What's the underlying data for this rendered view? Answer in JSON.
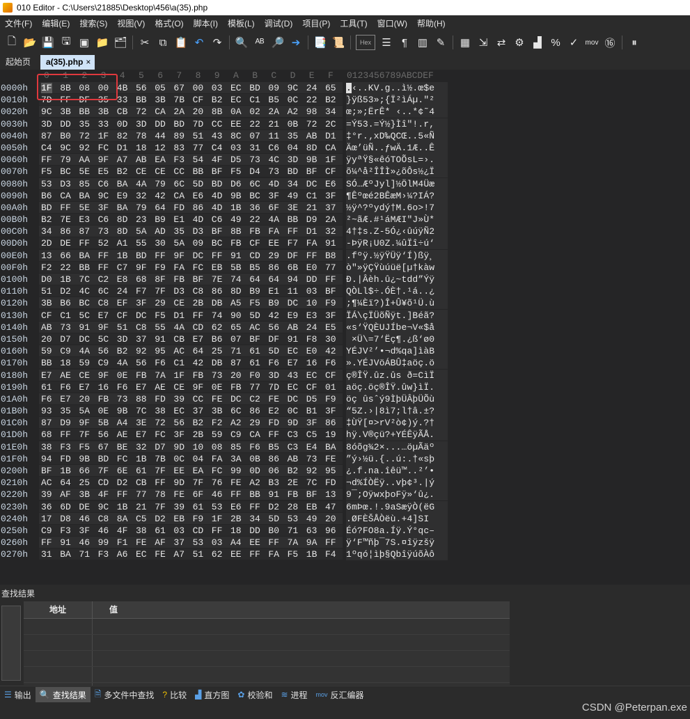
{
  "window": {
    "title": "010 Editor - C:\\Users\\21885\\Desktop\\456\\a(35).php"
  },
  "menu": [
    "文件(F)",
    "编辑(E)",
    "搜索(S)",
    "视图(V)",
    "格式(O)",
    "脚本(I)",
    "模板(L)",
    "调试(D)",
    "项目(P)",
    "工具(T)",
    "窗口(W)",
    "帮助(H)"
  ],
  "toolbar": {
    "hex_label": "Hex",
    "mov_label": "mov"
  },
  "tabs": {
    "start": "起始页",
    "active": "a(35).php",
    "close": "×"
  },
  "editor": {
    "columns": [
      "0",
      "1",
      "2",
      "3",
      "4",
      "5",
      "6",
      "7",
      "8",
      "9",
      "A",
      "B",
      "C",
      "D",
      "E",
      "F"
    ],
    "ascii_header": "0123456789ABCDEF",
    "rows": [
      {
        "addr": "0000h",
        "hex": [
          "1F",
          "8B",
          "08",
          "00",
          "4B",
          "56",
          "05",
          "67",
          "00",
          "03",
          "EC",
          "BD",
          "09",
          "9C",
          "24",
          "65"
        ],
        "ascii": ".‹..KV.g..ì½.œ$e"
      },
      {
        "addr": "0010h",
        "hex": [
          "7D",
          "FF",
          "DF",
          "35",
          "33",
          "BB",
          "3B",
          "7B",
          "CF",
          "B2",
          "EC",
          "C1",
          "B5",
          "0C",
          "22",
          "B2"
        ],
        "ascii": "}ÿß53»;{Ï²ìÁµ.\"²"
      },
      {
        "addr": "0020h",
        "hex": [
          "9C",
          "3B",
          "BB",
          "3B",
          "CB",
          "72",
          "CA",
          "2A",
          "20",
          "8B",
          "0A",
          "02",
          "2A",
          "A2",
          "98",
          "34"
        ],
        "ascii": "œ;»;ËrÊ* ‹..*¢˜4"
      },
      {
        "addr": "0030h",
        "hex": [
          "3D",
          "DD",
          "35",
          "33",
          "0D",
          "3D",
          "DD",
          "BD",
          "7D",
          "CC",
          "EE",
          "22",
          "21",
          "0B",
          "72",
          "2C"
        ],
        "ascii": "=Ý53.=Ý½}Ìî\"!.r,"
      },
      {
        "addr": "0040h",
        "hex": [
          "87",
          "B0",
          "72",
          "1F",
          "82",
          "78",
          "44",
          "89",
          "51",
          "43",
          "8C",
          "07",
          "11",
          "35",
          "AB",
          "D1"
        ],
        "ascii": "‡°r.‚xD‰QCŒ..5«Ñ"
      },
      {
        "addr": "0050h",
        "hex": [
          "C4",
          "9C",
          "92",
          "FC",
          "D1",
          "18",
          "12",
          "83",
          "77",
          "C4",
          "03",
          "31",
          "C6",
          "04",
          "8D",
          "CA"
        ],
        "ascii": "Äœ’üÑ..ƒwÄ.1Æ..Ê"
      },
      {
        "addr": "0060h",
        "hex": [
          "FF",
          "79",
          "AA",
          "9F",
          "A7",
          "AB",
          "EA",
          "F3",
          "54",
          "4F",
          "D5",
          "73",
          "4C",
          "3D",
          "9B",
          "1F"
        ],
        "ascii": "ÿyªŸ§«êóTOÕsL=›."
      },
      {
        "addr": "0070h",
        "hex": [
          "F5",
          "BC",
          "5E",
          "E5",
          "B2",
          "CE",
          "CE",
          "CC",
          "BB",
          "BF",
          "F5",
          "D4",
          "73",
          "BD",
          "BF",
          "CF"
        ],
        "ascii": "õ¼^å²ÎÎÌ»¿õÔs½¿Ï"
      },
      {
        "addr": "0080h",
        "hex": [
          "53",
          "D3",
          "85",
          "C6",
          "BA",
          "4A",
          "79",
          "6C",
          "5D",
          "BD",
          "D6",
          "6C",
          "4D",
          "34",
          "DC",
          "E6"
        ],
        "ascii": "SÓ…ÆºJyl]½ÖlM4Üæ"
      },
      {
        "addr": "0090h",
        "hex": [
          "B6",
          "CA",
          "BA",
          "9C",
          "E9",
          "32",
          "42",
          "CA",
          "E6",
          "4D",
          "9B",
          "BC",
          "3F",
          "49",
          "C1",
          "3F"
        ],
        "ascii": "¶Êºœé2BÊæM›¼?IÁ?"
      },
      {
        "addr": "00A0h",
        "hex": [
          "BD",
          "FF",
          "5E",
          "3F",
          "BA",
          "79",
          "64",
          "FD",
          "86",
          "4D",
          "1B",
          "36",
          "6F",
          "3E",
          "21",
          "37"
        ],
        "ascii": "½ÿ^?ºydý†M.6o>!7"
      },
      {
        "addr": "00B0h",
        "hex": [
          "B2",
          "7E",
          "E3",
          "C6",
          "8D",
          "23",
          "B9",
          "E1",
          "4D",
          "C6",
          "49",
          "22",
          "4A",
          "BB",
          "D9",
          "2A"
        ],
        "ascii": "²~ãÆ.#¹áMÆI\"J»Ù*"
      },
      {
        "addr": "00C0h",
        "hex": [
          "34",
          "86",
          "87",
          "73",
          "8D",
          "5A",
          "AD",
          "35",
          "D3",
          "BF",
          "8B",
          "FB",
          "FA",
          "FF",
          "D1",
          "32"
        ],
        "ascii": "4†‡s.Z-5Ó¿‹ûúÿÑ2"
      },
      {
        "addr": "00D0h",
        "hex": [
          "2D",
          "DE",
          "FF",
          "52",
          "A1",
          "55",
          "30",
          "5A",
          "09",
          "BC",
          "FB",
          "CF",
          "EE",
          "F7",
          "FA",
          "91"
        ],
        "ascii": "-ÞÿR¡U0Z.¼ûÏî÷ú‘"
      },
      {
        "addr": "00E0h",
        "hex": [
          "13",
          "66",
          "BA",
          "FF",
          "1B",
          "BD",
          "FF",
          "9F",
          "DC",
          "FF",
          "91",
          "CD",
          "29",
          "DF",
          "FF",
          "B8"
        ],
        "ascii": ".fºÿ.½ÿŸÜÿ‘Í)ßÿ¸"
      },
      {
        "addr": "00F0h",
        "hex": [
          "F2",
          "22",
          "BB",
          "FF",
          "C7",
          "9F",
          "F9",
          "FA",
          "FC",
          "EB",
          "5B",
          "B5",
          "86",
          "6B",
          "E0",
          "77"
        ],
        "ascii": "ò\"»ÿÇŸùúüë[µ†kàw"
      },
      {
        "addr": "0100h",
        "hex": [
          "D0",
          "1B",
          "7C",
          "C2",
          "E8",
          "68",
          "8F",
          "FB",
          "BF",
          "7E",
          "74",
          "64",
          "64",
          "94",
          "DD",
          "FF"
        ],
        "ascii": "Ð.|Âèh.û¿~tdd”Ýÿ"
      },
      {
        "addr": "0110h",
        "hex": [
          "51",
          "D2",
          "4C",
          "6C",
          "24",
          "F7",
          "7F",
          "D3",
          "C8",
          "86",
          "8D",
          "B9",
          "E1",
          "11",
          "03",
          "BF"
        ],
        "ascii": "QÒLl$÷.ÓÈ†.¹á..¿"
      },
      {
        "addr": "0120h",
        "hex": [
          "3B",
          "B6",
          "BC",
          "C8",
          "EF",
          "3F",
          "29",
          "CE",
          "2B",
          "DB",
          "A5",
          "F5",
          "B9",
          "DC",
          "10",
          "F9"
        ],
        "ascii": ";¶¼Èï?)Î+Û¥õ¹Ü.ù"
      },
      {
        "addr": "0130h",
        "hex": [
          "CF",
          "C1",
          "5C",
          "E7",
          "CF",
          "DC",
          "F5",
          "D1",
          "FF",
          "74",
          "90",
          "5D",
          "42",
          "E9",
          "E3",
          "3F"
        ],
        "ascii": "ÏÁ\\çÏÜõÑÿt.]Béã?"
      },
      {
        "addr": "0140h",
        "hex": [
          "AB",
          "73",
          "91",
          "9F",
          "51",
          "C8",
          "55",
          "4A",
          "CD",
          "62",
          "65",
          "AC",
          "56",
          "AB",
          "24",
          "E5"
        ],
        "ascii": "«s‘ŸQÈUJÍbe¬V«$å"
      },
      {
        "addr": "0150h",
        "hex": [
          "20",
          "D7",
          "DC",
          "5C",
          "3D",
          "37",
          "91",
          "CB",
          "E7",
          "B6",
          "07",
          "BF",
          "DF",
          "91",
          "F8",
          "30"
        ],
        "ascii": " ×Ü\\=7‘Ëç¶.¿ß‘ø0"
      },
      {
        "addr": "0160h",
        "hex": [
          "59",
          "C9",
          "4A",
          "56",
          "B2",
          "92",
          "95",
          "AC",
          "64",
          "25",
          "71",
          "61",
          "5D",
          "EC",
          "E0",
          "42"
        ],
        "ascii": "YÉJV²’•¬d%qa]ìàB"
      },
      {
        "addr": "0170h",
        "hex": [
          "BB",
          "18",
          "59",
          "C9",
          "4A",
          "56",
          "F6",
          "C1",
          "42",
          "DB",
          "87",
          "61",
          "F6",
          "E7",
          "16",
          "F6"
        ],
        "ascii": "».YÉJVöÁBÛ‡aöç.ö"
      },
      {
        "addr": "0180h",
        "hex": [
          "E7",
          "AE",
          "CE",
          "9F",
          "0E",
          "FB",
          "7A",
          "1F",
          "FB",
          "73",
          "20",
          "F0",
          "3D",
          "43",
          "EC",
          "CF"
        ],
        "ascii": "ç®ÎŸ.ûz.ûs ð=CìÏ"
      },
      {
        "addr": "0190h",
        "hex": [
          "61",
          "F6",
          "E7",
          "16",
          "F6",
          "E7",
          "AE",
          "CE",
          "9F",
          "0E",
          "FB",
          "77",
          "7D",
          "EC",
          "CF",
          "01"
        ],
        "ascii": "aöç.öç®ÎŸ.ûw}ìÏ."
      },
      {
        "addr": "01A0h",
        "hex": [
          "F6",
          "E7",
          "20",
          "FB",
          "73",
          "88",
          "FD",
          "39",
          "CC",
          "FE",
          "DC",
          "C2",
          "FE",
          "DC",
          "D5",
          "F9"
        ],
        "ascii": "öç ûsˆý9ÌþÜÂþÜÕù"
      },
      {
        "addr": "01B0h",
        "hex": [
          "93",
          "35",
          "5A",
          "0E",
          "9B",
          "7C",
          "38",
          "EC",
          "37",
          "3B",
          "6C",
          "86",
          "E2",
          "0C",
          "B1",
          "3F"
        ],
        "ascii": "“5Z.›|8ì7;l†â.±?"
      },
      {
        "addr": "01C0h",
        "hex": [
          "87",
          "D9",
          "9F",
          "5B",
          "A4",
          "3E",
          "72",
          "56",
          "B2",
          "F2",
          "A2",
          "29",
          "FD",
          "9D",
          "3F",
          "86"
        ],
        "ascii": "‡ÙŸ[¤>rV²ò¢)ý.?†"
      },
      {
        "addr": "01D0h",
        "hex": [
          "68",
          "FF",
          "7F",
          "56",
          "AE",
          "E7",
          "FC",
          "3F",
          "2B",
          "59",
          "C9",
          "CA",
          "FF",
          "C3",
          "C5",
          "19"
        ],
        "ascii": "hÿ.V®çü?+YÉÊÿÃÅ."
      },
      {
        "addr": "01E0h",
        "hex": [
          "38",
          "F3",
          "F5",
          "67",
          "BE",
          "32",
          "D7",
          "9D",
          "10",
          "08",
          "85",
          "F6",
          "B5",
          "C3",
          "E4",
          "BA"
        ],
        "ascii": "8óõg¾2×...…öµÃäº"
      },
      {
        "addr": "01F0h",
        "hex": [
          "94",
          "FD",
          "9B",
          "BD",
          "FC",
          "1B",
          "7B",
          "0C",
          "04",
          "FA",
          "3A",
          "0B",
          "86",
          "AB",
          "73",
          "FE"
        ],
        "ascii": "”ý›½ü.{..ú:.†«sþ"
      },
      {
        "addr": "0200h",
        "hex": [
          "BF",
          "1B",
          "66",
          "7F",
          "6E",
          "61",
          "7F",
          "EE",
          "EA",
          "FC",
          "99",
          "0D",
          "06",
          "B2",
          "92",
          "95"
        ],
        "ascii": "¿.f.na.îêü™..²’•"
      },
      {
        "addr": "0210h",
        "hex": [
          "AC",
          "64",
          "25",
          "CD",
          "D2",
          "CB",
          "FF",
          "9D",
          "7F",
          "76",
          "FE",
          "A2",
          "B3",
          "2E",
          "7C",
          "FD"
        ],
        "ascii": "¬d%ÍÒËÿ..vþ¢³.|ý"
      },
      {
        "addr": "0220h",
        "hex": [
          "39",
          "AF",
          "3B",
          "4F",
          "FF",
          "77",
          "78",
          "FE",
          "6F",
          "46",
          "FF",
          "BB",
          "91",
          "FB",
          "BF",
          "13"
        ],
        "ascii": "9¯;OÿwxþoFÿ»‘û¿."
      },
      {
        "addr": "0230h",
        "hex": [
          "36",
          "6D",
          "DE",
          "9C",
          "1B",
          "21",
          "7F",
          "39",
          "61",
          "53",
          "E6",
          "FF",
          "D2",
          "28",
          "EB",
          "47"
        ],
        "ascii": "6mÞœ.!.9aSæÿÒ(ëG"
      },
      {
        "addr": "0240h",
        "hex": [
          "17",
          "D8",
          "46",
          "C8",
          "8A",
          "C5",
          "D2",
          "EB",
          "F9",
          "1F",
          "2B",
          "34",
          "5D",
          "53",
          "49",
          "20"
        ],
        "ascii": ".ØFÈŠÅÒëù.+4]SI "
      },
      {
        "addr": "0250h",
        "hex": [
          "C9",
          "F3",
          "3F",
          "46",
          "4F",
          "38",
          "61",
          "03",
          "CD",
          "FF",
          "18",
          "DD",
          "B0",
          "71",
          "63",
          "96"
        ],
        "ascii": "Éó?FO8a.Íÿ.Ý°qc–"
      },
      {
        "addr": "0260h",
        "hex": [
          "FF",
          "91",
          "46",
          "99",
          "F1",
          "FE",
          "AF",
          "37",
          "53",
          "03",
          "A4",
          "EE",
          "FF",
          "7A",
          "9A",
          "FF"
        ],
        "ascii": "ÿ‘F™ñþ¯7S.¤îÿzšÿ"
      },
      {
        "addr": "0270h",
        "hex": [
          "31",
          "BA",
          "71",
          "F3",
          "A6",
          "EC",
          "FE",
          "A7",
          "51",
          "62",
          "EE",
          "FF",
          "FA",
          "F5",
          "1B",
          "F4"
        ],
        "ascii": "1ºqó¦ìþ§QbîÿúõÀô"
      }
    ]
  },
  "find_results": {
    "title": "查找结果",
    "col_address": "地址",
    "col_value": "值",
    "empty_rows": 5
  },
  "bottom_tabs": [
    {
      "icon": "output-icon",
      "label": "输出",
      "active": false
    },
    {
      "icon": "find-results-icon",
      "label": "查找结果",
      "active": true
    },
    {
      "icon": "find-in-files-icon",
      "label": "多文件中查找",
      "active": false
    },
    {
      "icon": "compare-icon",
      "label": "比较",
      "active": false
    },
    {
      "icon": "histogram-icon",
      "label": "直方图",
      "active": false
    },
    {
      "icon": "checksum-icon",
      "label": "校验和",
      "active": false
    },
    {
      "icon": "process-icon",
      "label": "进程",
      "active": false
    },
    {
      "icon": "disassembler-icon",
      "label": "反汇编器",
      "active": false
    }
  ],
  "watermark": "CSDN @Peterpan.exe"
}
